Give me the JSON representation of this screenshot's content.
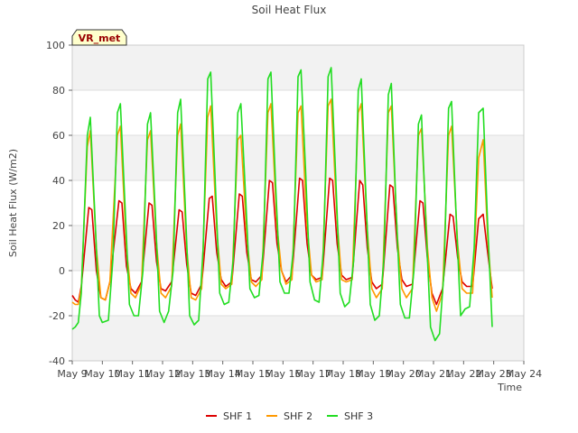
{
  "chart_data": {
    "type": "line",
    "title": "Soil Heat Flux",
    "xlabel": "Time",
    "ylabel": "Soil Heat Flux (W/m2)",
    "ylim": [
      -40,
      100
    ],
    "xlim": [
      0,
      15
    ],
    "y_ticks": [
      -40,
      -20,
      0,
      20,
      40,
      60,
      80,
      100
    ],
    "x_ticks": [
      {
        "x": 0,
        "label": "May 9"
      },
      {
        "x": 1,
        "label": "May 10"
      },
      {
        "x": 2,
        "label": "May 11"
      },
      {
        "x": 3,
        "label": "May 12"
      },
      {
        "x": 4,
        "label": "May 13"
      },
      {
        "x": 5,
        "label": "May 14"
      },
      {
        "x": 6,
        "label": "May 15"
      },
      {
        "x": 7,
        "label": "May 16"
      },
      {
        "x": 8,
        "label": "May 17"
      },
      {
        "x": 9,
        "label": "May 18"
      },
      {
        "x": 10,
        "label": "May 19"
      },
      {
        "x": 11,
        "label": "May 20"
      },
      {
        "x": 12,
        "label": "May 21"
      },
      {
        "x": 13,
        "label": "May 22"
      },
      {
        "x": 14,
        "label": "May 23"
      },
      {
        "x": 15,
        "label": "May 24"
      }
    ],
    "annotation": "VR_met",
    "grid": true,
    "legend_position": "bottom-center",
    "series": [
      {
        "name": "SHF 1",
        "color": "#dd0000",
        "points": [
          [
            0.0,
            -11
          ],
          [
            0.1,
            -13
          ],
          [
            0.2,
            -14
          ],
          [
            0.3,
            -7
          ],
          [
            0.55,
            28
          ],
          [
            0.65,
            27
          ],
          [
            0.8,
            0
          ],
          [
            0.95,
            -12
          ],
          [
            1.1,
            -13
          ],
          [
            1.25,
            -5
          ],
          [
            1.55,
            31
          ],
          [
            1.65,
            30
          ],
          [
            1.8,
            2
          ],
          [
            1.95,
            -8
          ],
          [
            2.1,
            -10
          ],
          [
            2.3,
            -5
          ],
          [
            2.55,
            30
          ],
          [
            2.65,
            29
          ],
          [
            2.8,
            4
          ],
          [
            2.95,
            -8
          ],
          [
            3.1,
            -9
          ],
          [
            3.3,
            -5
          ],
          [
            3.55,
            27
          ],
          [
            3.65,
            26
          ],
          [
            3.8,
            3
          ],
          [
            3.95,
            -10
          ],
          [
            4.1,
            -11
          ],
          [
            4.3,
            -6
          ],
          [
            4.55,
            32
          ],
          [
            4.65,
            33
          ],
          [
            4.8,
            8
          ],
          [
            4.95,
            -4
          ],
          [
            5.1,
            -7
          ],
          [
            5.3,
            -5
          ],
          [
            5.55,
            34
          ],
          [
            5.65,
            33
          ],
          [
            5.8,
            8
          ],
          [
            5.95,
            -4
          ],
          [
            6.1,
            -5
          ],
          [
            6.3,
            -2
          ],
          [
            6.55,
            40
          ],
          [
            6.65,
            39
          ],
          [
            6.8,
            12
          ],
          [
            6.95,
            0
          ],
          [
            7.1,
            -5
          ],
          [
            7.3,
            -2
          ],
          [
            7.55,
            41
          ],
          [
            7.65,
            40
          ],
          [
            7.8,
            12
          ],
          [
            7.95,
            -2
          ],
          [
            8.1,
            -4
          ],
          [
            8.3,
            -3
          ],
          [
            8.55,
            41
          ],
          [
            8.65,
            40
          ],
          [
            8.8,
            12
          ],
          [
            8.95,
            -2
          ],
          [
            9.1,
            -4
          ],
          [
            9.3,
            -3
          ],
          [
            9.55,
            40
          ],
          [
            9.65,
            38
          ],
          [
            9.8,
            10
          ],
          [
            9.95,
            -5
          ],
          [
            10.1,
            -8
          ],
          [
            10.3,
            -6
          ],
          [
            10.55,
            38
          ],
          [
            10.65,
            37
          ],
          [
            10.8,
            10
          ],
          [
            10.95,
            -4
          ],
          [
            11.1,
            -7
          ],
          [
            11.3,
            -6
          ],
          [
            11.55,
            31
          ],
          [
            11.65,
            30
          ],
          [
            11.8,
            5
          ],
          [
            11.95,
            -10
          ],
          [
            12.1,
            -15
          ],
          [
            12.3,
            -8
          ],
          [
            12.55,
            25
          ],
          [
            12.65,
            24
          ],
          [
            12.8,
            6
          ],
          [
            12.95,
            -5
          ],
          [
            13.1,
            -7
          ],
          [
            13.3,
            -7
          ],
          [
            13.5,
            23
          ],
          [
            13.65,
            25
          ],
          [
            13.8,
            8
          ],
          [
            13.95,
            -8
          ]
        ]
      },
      {
        "name": "SHF 2",
        "color": "#ff9900",
        "points": [
          [
            0.0,
            -14
          ],
          [
            0.1,
            -15
          ],
          [
            0.2,
            -15
          ],
          [
            0.3,
            -8
          ],
          [
            0.5,
            55
          ],
          [
            0.6,
            62
          ],
          [
            0.8,
            10
          ],
          [
            0.95,
            -12
          ],
          [
            1.1,
            -13
          ],
          [
            1.25,
            -5
          ],
          [
            1.5,
            60
          ],
          [
            1.6,
            64
          ],
          [
            1.8,
            10
          ],
          [
            1.95,
            -10
          ],
          [
            2.1,
            -12
          ],
          [
            2.3,
            -6
          ],
          [
            2.5,
            58
          ],
          [
            2.6,
            62
          ],
          [
            2.8,
            12
          ],
          [
            2.95,
            -10
          ],
          [
            3.1,
            -12
          ],
          [
            3.3,
            -7
          ],
          [
            3.5,
            60
          ],
          [
            3.6,
            65
          ],
          [
            3.8,
            10
          ],
          [
            3.95,
            -12
          ],
          [
            4.1,
            -13
          ],
          [
            4.3,
            -8
          ],
          [
            4.5,
            68
          ],
          [
            4.6,
            73
          ],
          [
            4.8,
            18
          ],
          [
            4.95,
            -6
          ],
          [
            5.1,
            -8
          ],
          [
            5.3,
            -6
          ],
          [
            5.5,
            58
          ],
          [
            5.6,
            60
          ],
          [
            5.8,
            15
          ],
          [
            5.95,
            -5
          ],
          [
            6.1,
            -7
          ],
          [
            6.3,
            -4
          ],
          [
            6.5,
            70
          ],
          [
            6.6,
            74
          ],
          [
            6.8,
            20
          ],
          [
            6.95,
            0
          ],
          [
            7.1,
            -6
          ],
          [
            7.3,
            -4
          ],
          [
            7.5,
            70
          ],
          [
            7.6,
            73
          ],
          [
            7.8,
            20
          ],
          [
            7.95,
            -2
          ],
          [
            8.1,
            -5
          ],
          [
            8.3,
            -4
          ],
          [
            8.5,
            73
          ],
          [
            8.6,
            76
          ],
          [
            8.8,
            22
          ],
          [
            8.95,
            -4
          ],
          [
            9.1,
            -5
          ],
          [
            9.3,
            -4
          ],
          [
            9.5,
            70
          ],
          [
            9.6,
            74
          ],
          [
            9.8,
            18
          ],
          [
            9.95,
            -8
          ],
          [
            10.1,
            -12
          ],
          [
            10.3,
            -8
          ],
          [
            10.5,
            70
          ],
          [
            10.6,
            73
          ],
          [
            10.8,
            15
          ],
          [
            10.95,
            -8
          ],
          [
            11.1,
            -12
          ],
          [
            11.3,
            -8
          ],
          [
            11.5,
            60
          ],
          [
            11.6,
            63
          ],
          [
            11.8,
            10
          ],
          [
            11.95,
            -12
          ],
          [
            12.1,
            -18
          ],
          [
            12.3,
            -10
          ],
          [
            12.5,
            60
          ],
          [
            12.6,
            64
          ],
          [
            12.8,
            12
          ],
          [
            12.95,
            -8
          ],
          [
            13.1,
            -10
          ],
          [
            13.3,
            -10
          ],
          [
            13.5,
            50
          ],
          [
            13.65,
            58
          ],
          [
            13.8,
            15
          ],
          [
            13.95,
            -12
          ]
        ]
      },
      {
        "name": "SHF 3",
        "color": "#22dd22",
        "points": [
          [
            0.0,
            -26
          ],
          [
            0.1,
            -25
          ],
          [
            0.2,
            -23
          ],
          [
            0.3,
            -10
          ],
          [
            0.5,
            60
          ],
          [
            0.6,
            68
          ],
          [
            0.75,
            25
          ],
          [
            0.9,
            -20
          ],
          [
            1.0,
            -23
          ],
          [
            1.2,
            -22
          ],
          [
            1.35,
            5
          ],
          [
            1.5,
            70
          ],
          [
            1.6,
            74
          ],
          [
            1.75,
            30
          ],
          [
            1.9,
            -15
          ],
          [
            2.05,
            -20
          ],
          [
            2.2,
            -20
          ],
          [
            2.35,
            0
          ],
          [
            2.5,
            65
          ],
          [
            2.6,
            70
          ],
          [
            2.75,
            28
          ],
          [
            2.9,
            -18
          ],
          [
            3.05,
            -23
          ],
          [
            3.2,
            -18
          ],
          [
            3.35,
            0
          ],
          [
            3.5,
            70
          ],
          [
            3.6,
            76
          ],
          [
            3.75,
            30
          ],
          [
            3.9,
            -20
          ],
          [
            4.05,
            -24
          ],
          [
            4.2,
            -22
          ],
          [
            4.35,
            10
          ],
          [
            4.5,
            85
          ],
          [
            4.6,
            88
          ],
          [
            4.75,
            40
          ],
          [
            4.9,
            -10
          ],
          [
            5.05,
            -15
          ],
          [
            5.2,
            -14
          ],
          [
            5.35,
            5
          ],
          [
            5.5,
            70
          ],
          [
            5.6,
            74
          ],
          [
            5.75,
            35
          ],
          [
            5.9,
            -8
          ],
          [
            6.05,
            -12
          ],
          [
            6.2,
            -11
          ],
          [
            6.35,
            10
          ],
          [
            6.5,
            85
          ],
          [
            6.6,
            88
          ],
          [
            6.75,
            40
          ],
          [
            6.9,
            -5
          ],
          [
            7.05,
            -10
          ],
          [
            7.2,
            -10
          ],
          [
            7.35,
            10
          ],
          [
            7.5,
            86
          ],
          [
            7.6,
            89
          ],
          [
            7.75,
            45
          ],
          [
            7.9,
            -5
          ],
          [
            8.05,
            -13
          ],
          [
            8.2,
            -14
          ],
          [
            8.35,
            10
          ],
          [
            8.5,
            86
          ],
          [
            8.6,
            90
          ],
          [
            8.75,
            42
          ],
          [
            8.9,
            -10
          ],
          [
            9.05,
            -16
          ],
          [
            9.2,
            -14
          ],
          [
            9.35,
            5
          ],
          [
            9.5,
            80
          ],
          [
            9.6,
            85
          ],
          [
            9.75,
            35
          ],
          [
            9.9,
            -15
          ],
          [
            10.05,
            -22
          ],
          [
            10.2,
            -20
          ],
          [
            10.35,
            5
          ],
          [
            10.5,
            78
          ],
          [
            10.6,
            83
          ],
          [
            10.75,
            30
          ],
          [
            10.9,
            -15
          ],
          [
            11.05,
            -21
          ],
          [
            11.2,
            -21
          ],
          [
            11.35,
            0
          ],
          [
            11.5,
            65
          ],
          [
            11.6,
            69
          ],
          [
            11.75,
            20
          ],
          [
            11.9,
            -25
          ],
          [
            12.05,
            -31
          ],
          [
            12.2,
            -28
          ],
          [
            12.35,
            0
          ],
          [
            12.5,
            72
          ],
          [
            12.6,
            75
          ],
          [
            12.75,
            25
          ],
          [
            12.9,
            -20
          ],
          [
            13.05,
            -17
          ],
          [
            13.2,
            -16
          ],
          [
            13.35,
            10
          ],
          [
            13.5,
            70
          ],
          [
            13.65,
            72
          ],
          [
            13.8,
            20
          ],
          [
            13.95,
            -25
          ]
        ]
      }
    ]
  }
}
